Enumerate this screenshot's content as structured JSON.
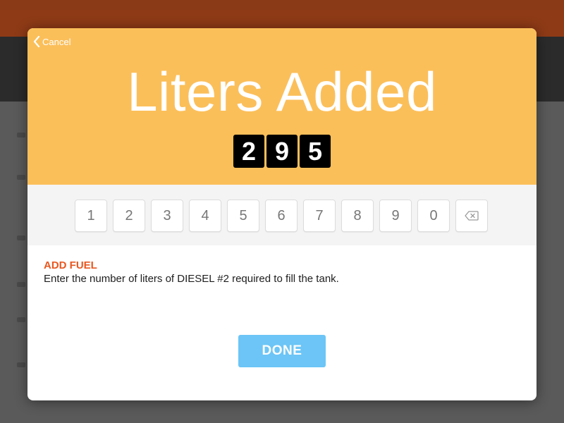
{
  "modal": {
    "cancel_label": "Cancel",
    "title": "Liters Added",
    "digits": [
      "2",
      "9",
      "5"
    ],
    "keypad": {
      "keys": [
        "1",
        "2",
        "3",
        "4",
        "5",
        "6",
        "7",
        "8",
        "9",
        "0"
      ],
      "backspace_icon": "backspace-icon"
    },
    "info": {
      "heading": "ADD FUEL",
      "text": "Enter the number of liters of DIESEL #2 required to fill the tank."
    },
    "done_label": "DONE"
  },
  "colors": {
    "hero": "#fbbf5a",
    "accent": "#e8571f",
    "done_button": "#6cc5f6",
    "digit_background": "#000000"
  }
}
